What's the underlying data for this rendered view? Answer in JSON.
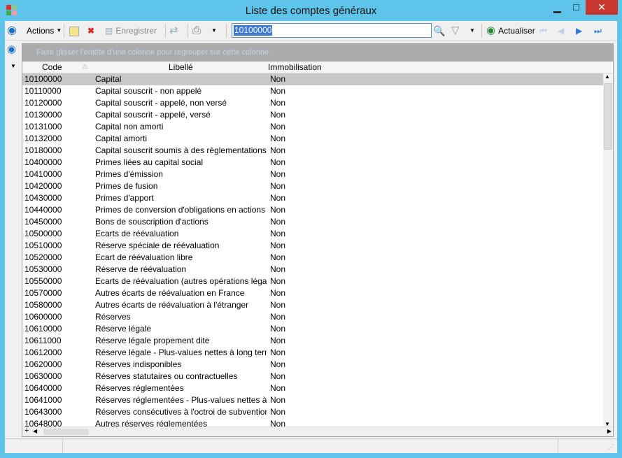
{
  "window": {
    "title": "Liste des comptes généraux",
    "minimize": "▁",
    "maximize": "□",
    "close": "✕"
  },
  "toolbar": {
    "actions": "Actions",
    "save": "Enregistrer",
    "search_value": "10100000",
    "refresh": "Actualiser"
  },
  "grid": {
    "group_hint": "Faire glisser l'entête d'une colonne pour regrouper sur cette colonne.",
    "columns": [
      "Code",
      "Libellé",
      "Immobilisation"
    ],
    "rows": [
      [
        "10100000",
        "Capital",
        "Non"
      ],
      [
        "10110000",
        "Capital souscrit - non appelé",
        "Non"
      ],
      [
        "10120000",
        "Capital souscrit - appelé, non versé",
        "Non"
      ],
      [
        "10130000",
        "Capital souscrit - appelé, versé",
        "Non"
      ],
      [
        "10131000",
        "Capital non amorti",
        "Non"
      ],
      [
        "10132000",
        "Capital amorti",
        "Non"
      ],
      [
        "10180000",
        "Capital souscrit soumis à des règlementations",
        "Non"
      ],
      [
        "10400000",
        "Primes liées au capital social",
        "Non"
      ],
      [
        "10410000",
        "Primes d'émission",
        "Non"
      ],
      [
        "10420000",
        "Primes de fusion",
        "Non"
      ],
      [
        "10430000",
        "Primes d'apport",
        "Non"
      ],
      [
        "10440000",
        "Primes de conversion d'obligations en actions",
        "Non"
      ],
      [
        "10450000",
        "Bons de souscription d'actions",
        "Non"
      ],
      [
        "10500000",
        "Ecarts de réévaluation",
        "Non"
      ],
      [
        "10510000",
        "Réserve spéciale de réévaluation",
        "Non"
      ],
      [
        "10520000",
        "Ecart de réévaluation libre",
        "Non"
      ],
      [
        "10530000",
        "Réserve de réévaluation",
        "Non"
      ],
      [
        "10550000",
        "Ecarts de réévaluation (autres opérations légales)",
        "Non"
      ],
      [
        "10570000",
        "Autres écarts de réévaluation en France",
        "Non"
      ],
      [
        "10580000",
        "Autres écarts de réévaluation à l'étranger",
        "Non"
      ],
      [
        "10600000",
        "Réserves",
        "Non"
      ],
      [
        "10610000",
        "Réserve légale",
        "Non"
      ],
      [
        "10611000",
        "Réserve légale propement dite",
        "Non"
      ],
      [
        "10612000",
        "Réserve légale - Plus-values nettes à long terme",
        "Non"
      ],
      [
        "10620000",
        "Réserves indisponibles",
        "Non"
      ],
      [
        "10630000",
        "Réserves statutaires ou contractuelles",
        "Non"
      ],
      [
        "10640000",
        "Réserves réglementées",
        "Non"
      ],
      [
        "10641000",
        "Réserves réglementées - Plus-values nettes à long terme",
        "Non"
      ],
      [
        "10643000",
        "Réserves consécutives à l'octroi de subventions",
        "Non"
      ],
      [
        "10648000",
        "Autres réserves réglementées",
        "Non"
      ]
    ]
  }
}
